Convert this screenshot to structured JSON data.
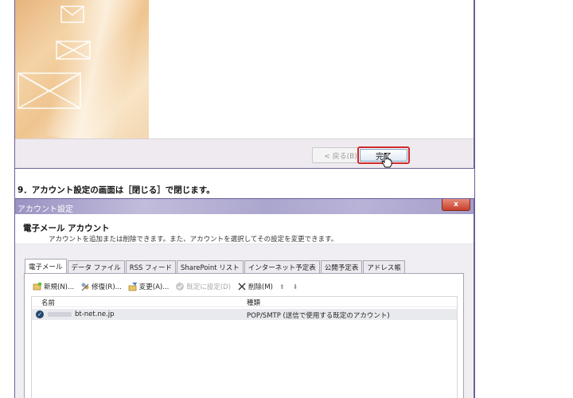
{
  "wizard": {
    "back_label": "< 戻る(B)",
    "finish_label": "完了"
  },
  "step_instruction": "9．アカウント設定の画面は［閉じる］で閉じます。",
  "account_settings": {
    "window_title": "アカウント設定",
    "close_glyph": "x",
    "header_title": "電子メール アカウント",
    "header_description": "アカウントを追加または削除できます。また、アカウントを選択してその設定を変更できます。",
    "tabs": [
      {
        "label": "電子メール"
      },
      {
        "label": "データ ファイル"
      },
      {
        "label": "RSS フィード"
      },
      {
        "label": "SharePoint リスト"
      },
      {
        "label": "インターネット予定表"
      },
      {
        "label": "公開予定表"
      },
      {
        "label": "アドレス帳"
      }
    ],
    "toolbar": {
      "new_label": "新規(N)...",
      "repair_label": "修復(R)...",
      "change_label": "変更(A)...",
      "set_default_label": "既定に設定(D)",
      "remove_label": "削除(M)",
      "move_up_glyph": "⬆",
      "move_down_glyph": "⬇"
    },
    "columns": {
      "name": "名前",
      "type": "種類"
    },
    "accounts": [
      {
        "name": "bt-net.ne.jp",
        "type": "POP/SMTP (送信で使用する既定のアカウント)"
      }
    ]
  }
}
